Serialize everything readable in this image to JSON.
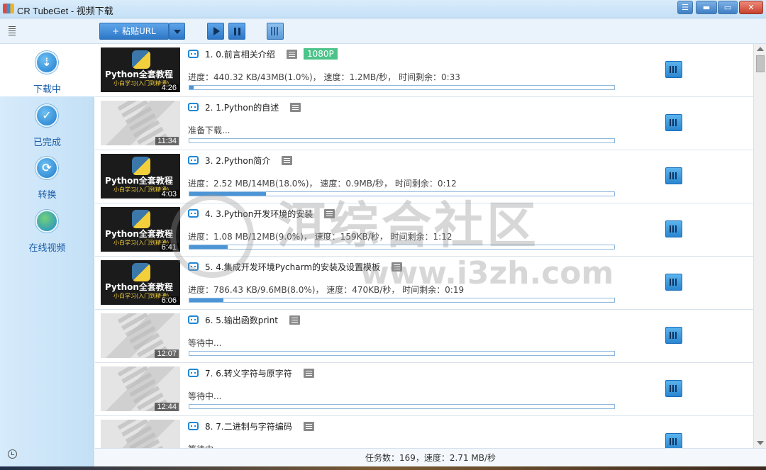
{
  "window": {
    "title": "CR TubeGet - 视频下载",
    "menu_glyph": "☰",
    "min_glyph": "▬",
    "max_glyph": "▭",
    "close_glyph": "✕"
  },
  "toolbar": {
    "paste_url_label": "+ 粘贴URL"
  },
  "sidebar": {
    "items": [
      {
        "label": "下载中",
        "icon": "download-icon",
        "glyph": "⇣"
      },
      {
        "label": "已完成",
        "icon": "check-icon",
        "glyph": "✓"
      },
      {
        "label": "转换",
        "icon": "convert-icon",
        "glyph": "⟳"
      },
      {
        "label": "在线视频",
        "icon": "globe-icon",
        "glyph": ""
      }
    ]
  },
  "downloads": [
    {
      "title": "1. 0.前言相关介绍",
      "duration": "4:26",
      "thumb": "python",
      "resolution": "1080P",
      "status": "进度：440.32 KB/43MB(1.0%)， 速度：1.2MB/秒， 时间剩余：0:33",
      "progress": 0.01
    },
    {
      "title": "2. 1.Python的自述",
      "duration": "11:34",
      "thumb": "placeholder",
      "resolution": "",
      "status": "准备下载...",
      "progress": 0
    },
    {
      "title": "3. 2.Python简介",
      "duration": "4:03",
      "thumb": "python",
      "resolution": "",
      "status": "进度：2.52 MB/14MB(18.0%)， 速度：0.9MB/秒， 时间剩余：0:12",
      "progress": 0.18
    },
    {
      "title": "4. 3.Python开发环境的安装",
      "duration": "6:41",
      "thumb": "python",
      "resolution": "",
      "status": "进度：1.08 MB/12MB(9.0%)， 速度：159KB/秒， 时间剩余：1:12",
      "progress": 0.09
    },
    {
      "title": "5. 4.集成开发环境Pycharm的安装及设置模板",
      "duration": "6:06",
      "thumb": "python",
      "resolution": "",
      "status": "进度：786.43 KB/9.6MB(8.0%)， 速度：470KB/秒， 时间剩余：0:19",
      "progress": 0.08
    },
    {
      "title": "6. 5.输出函数print",
      "duration": "12:07",
      "thumb": "placeholder",
      "resolution": "",
      "status": "等待中...",
      "progress": 0
    },
    {
      "title": "7. 6.转义字符与原字符",
      "duration": "12:44",
      "thumb": "placeholder",
      "resolution": "",
      "status": "等待中...",
      "progress": 0
    },
    {
      "title": "8. 7.二进制与字符编码",
      "duration": "",
      "thumb": "placeholder",
      "resolution": "",
      "status": "等待中...",
      "progress": 0
    }
  ],
  "thumb_text": {
    "title": "Python全套教程",
    "subtitle": "小白学习(入门到精通)"
  },
  "statusbar": {
    "text": "任务数：169，速度：2.71 MB/秒"
  },
  "watermark": {
    "main": "洱综合社区",
    "url": "www.i3zh.com"
  },
  "colors": {
    "accent": "#2c77c6",
    "progress": "#4b95d6",
    "badge": "#4cc38a",
    "sidebar": "#c3e0f6"
  }
}
